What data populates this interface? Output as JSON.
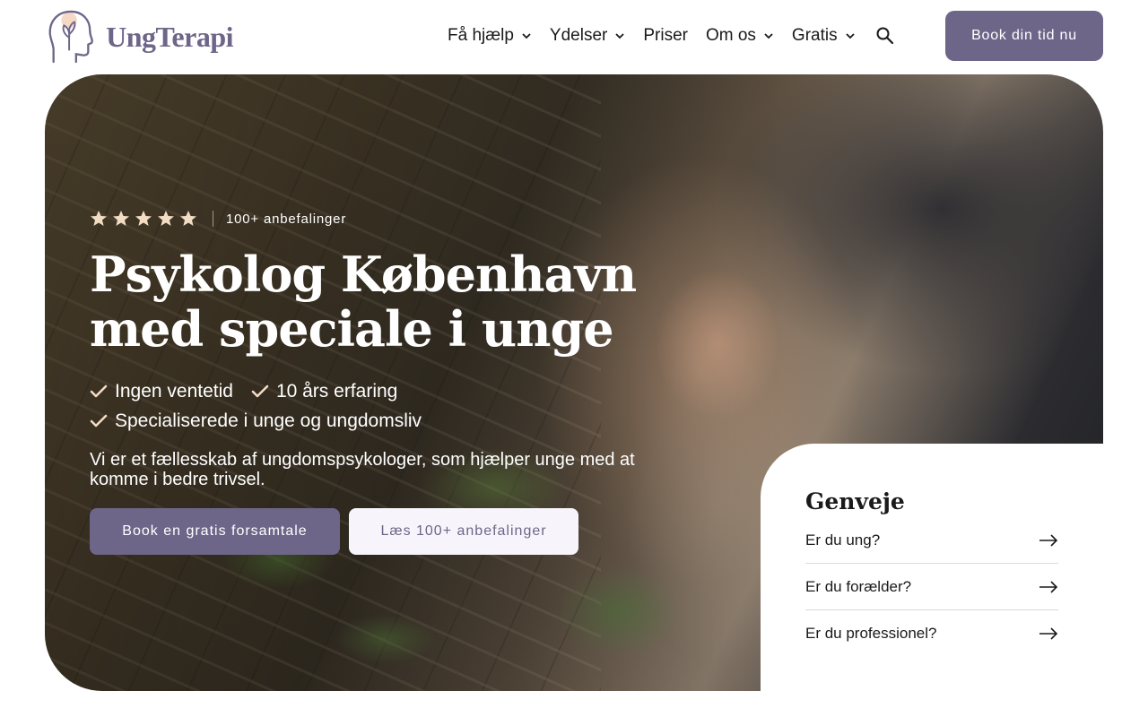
{
  "brand": {
    "name": "UngTerapi",
    "color": "#6e6689"
  },
  "nav": {
    "items": [
      {
        "label": "Få hjælp",
        "has_dropdown": true
      },
      {
        "label": "Ydelser",
        "has_dropdown": true
      },
      {
        "label": "Priser",
        "has_dropdown": false
      },
      {
        "label": "Om os",
        "has_dropdown": true
      },
      {
        "label": "Gratis",
        "has_dropdown": true
      }
    ],
    "search_icon": "search-icon",
    "cta_label": "Book din tid nu"
  },
  "hero": {
    "rating_stars": 5,
    "rating_text": "100+ anbefalinger",
    "star_color": "#f3dcc4",
    "title": "Psykolog København med speciale i unge",
    "checks": [
      "Ingen ventetid",
      "10 års erfaring",
      "Specialiserede i unge og ungdomsliv"
    ],
    "description": "Vi er et fællesskab af ungdomspsykologer, som hjælper unge med at komme i bedre trivsel.",
    "primary_button": "Book en gratis forsamtale",
    "secondary_button": "Læs 100+ anbefalinger"
  },
  "shortcuts": {
    "title": "Genveje",
    "items": [
      "Er du ung?",
      "Er du forælder?",
      "Er du professionel?"
    ]
  }
}
